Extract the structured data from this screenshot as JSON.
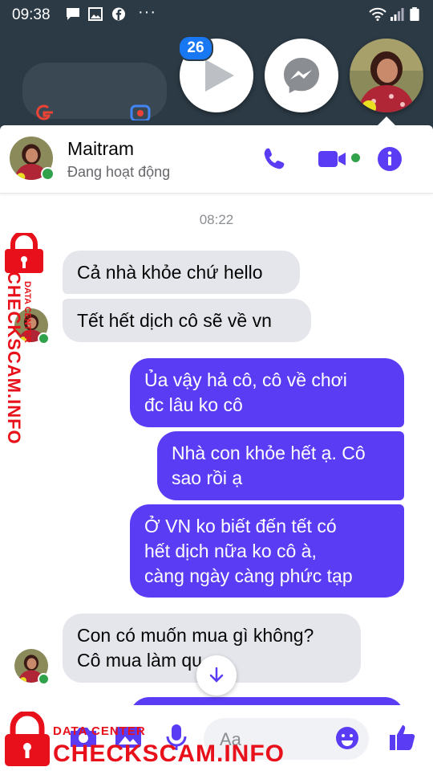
{
  "status_bar": {
    "time": "09:38",
    "icons": [
      "message-icon",
      "image-icon",
      "facebook-icon",
      "more-dots-icon",
      "wifi-icon",
      "signal-icon",
      "battery-icon"
    ],
    "more": "···"
  },
  "chat_heads": {
    "badge_count": "26"
  },
  "header": {
    "name": "Maitram",
    "status": "Đang hoạt động"
  },
  "thread": {
    "timestamp": "08:22",
    "messages": [
      {
        "dir": "in",
        "text": "Cả nhà khỏe chứ hello"
      },
      {
        "dir": "in",
        "text": "Tết hết dịch cô sẽ về vn"
      },
      {
        "dir": "out",
        "text": "Ủa vậy hả cô, cô về chơi\nđc lâu ko cô"
      },
      {
        "dir": "out",
        "text": "Nhà con khỏe hết ạ. Cô\nsao rồi ạ"
      },
      {
        "dir": "out",
        "text": "Ở VN ko biết đến tết có\nhết dịch nữa ko cô à,\ncàng ngày càng phức tạp"
      },
      {
        "dir": "in",
        "text": "Con có muốn mua gì không?\nCô mua làm qu"
      }
    ]
  },
  "composer": {
    "placeholder": "Aa"
  },
  "watermark": {
    "small": "DATA CENTER",
    "big": "CHECKSCAM.INFO",
    "side": "CHECKSCAM.INFO",
    "side_small": "DATA CENTER"
  },
  "colors": {
    "accent": "#5b3cf5",
    "online": "#31a24c",
    "badge": "#1877f2",
    "watermark": "#e8101a"
  }
}
